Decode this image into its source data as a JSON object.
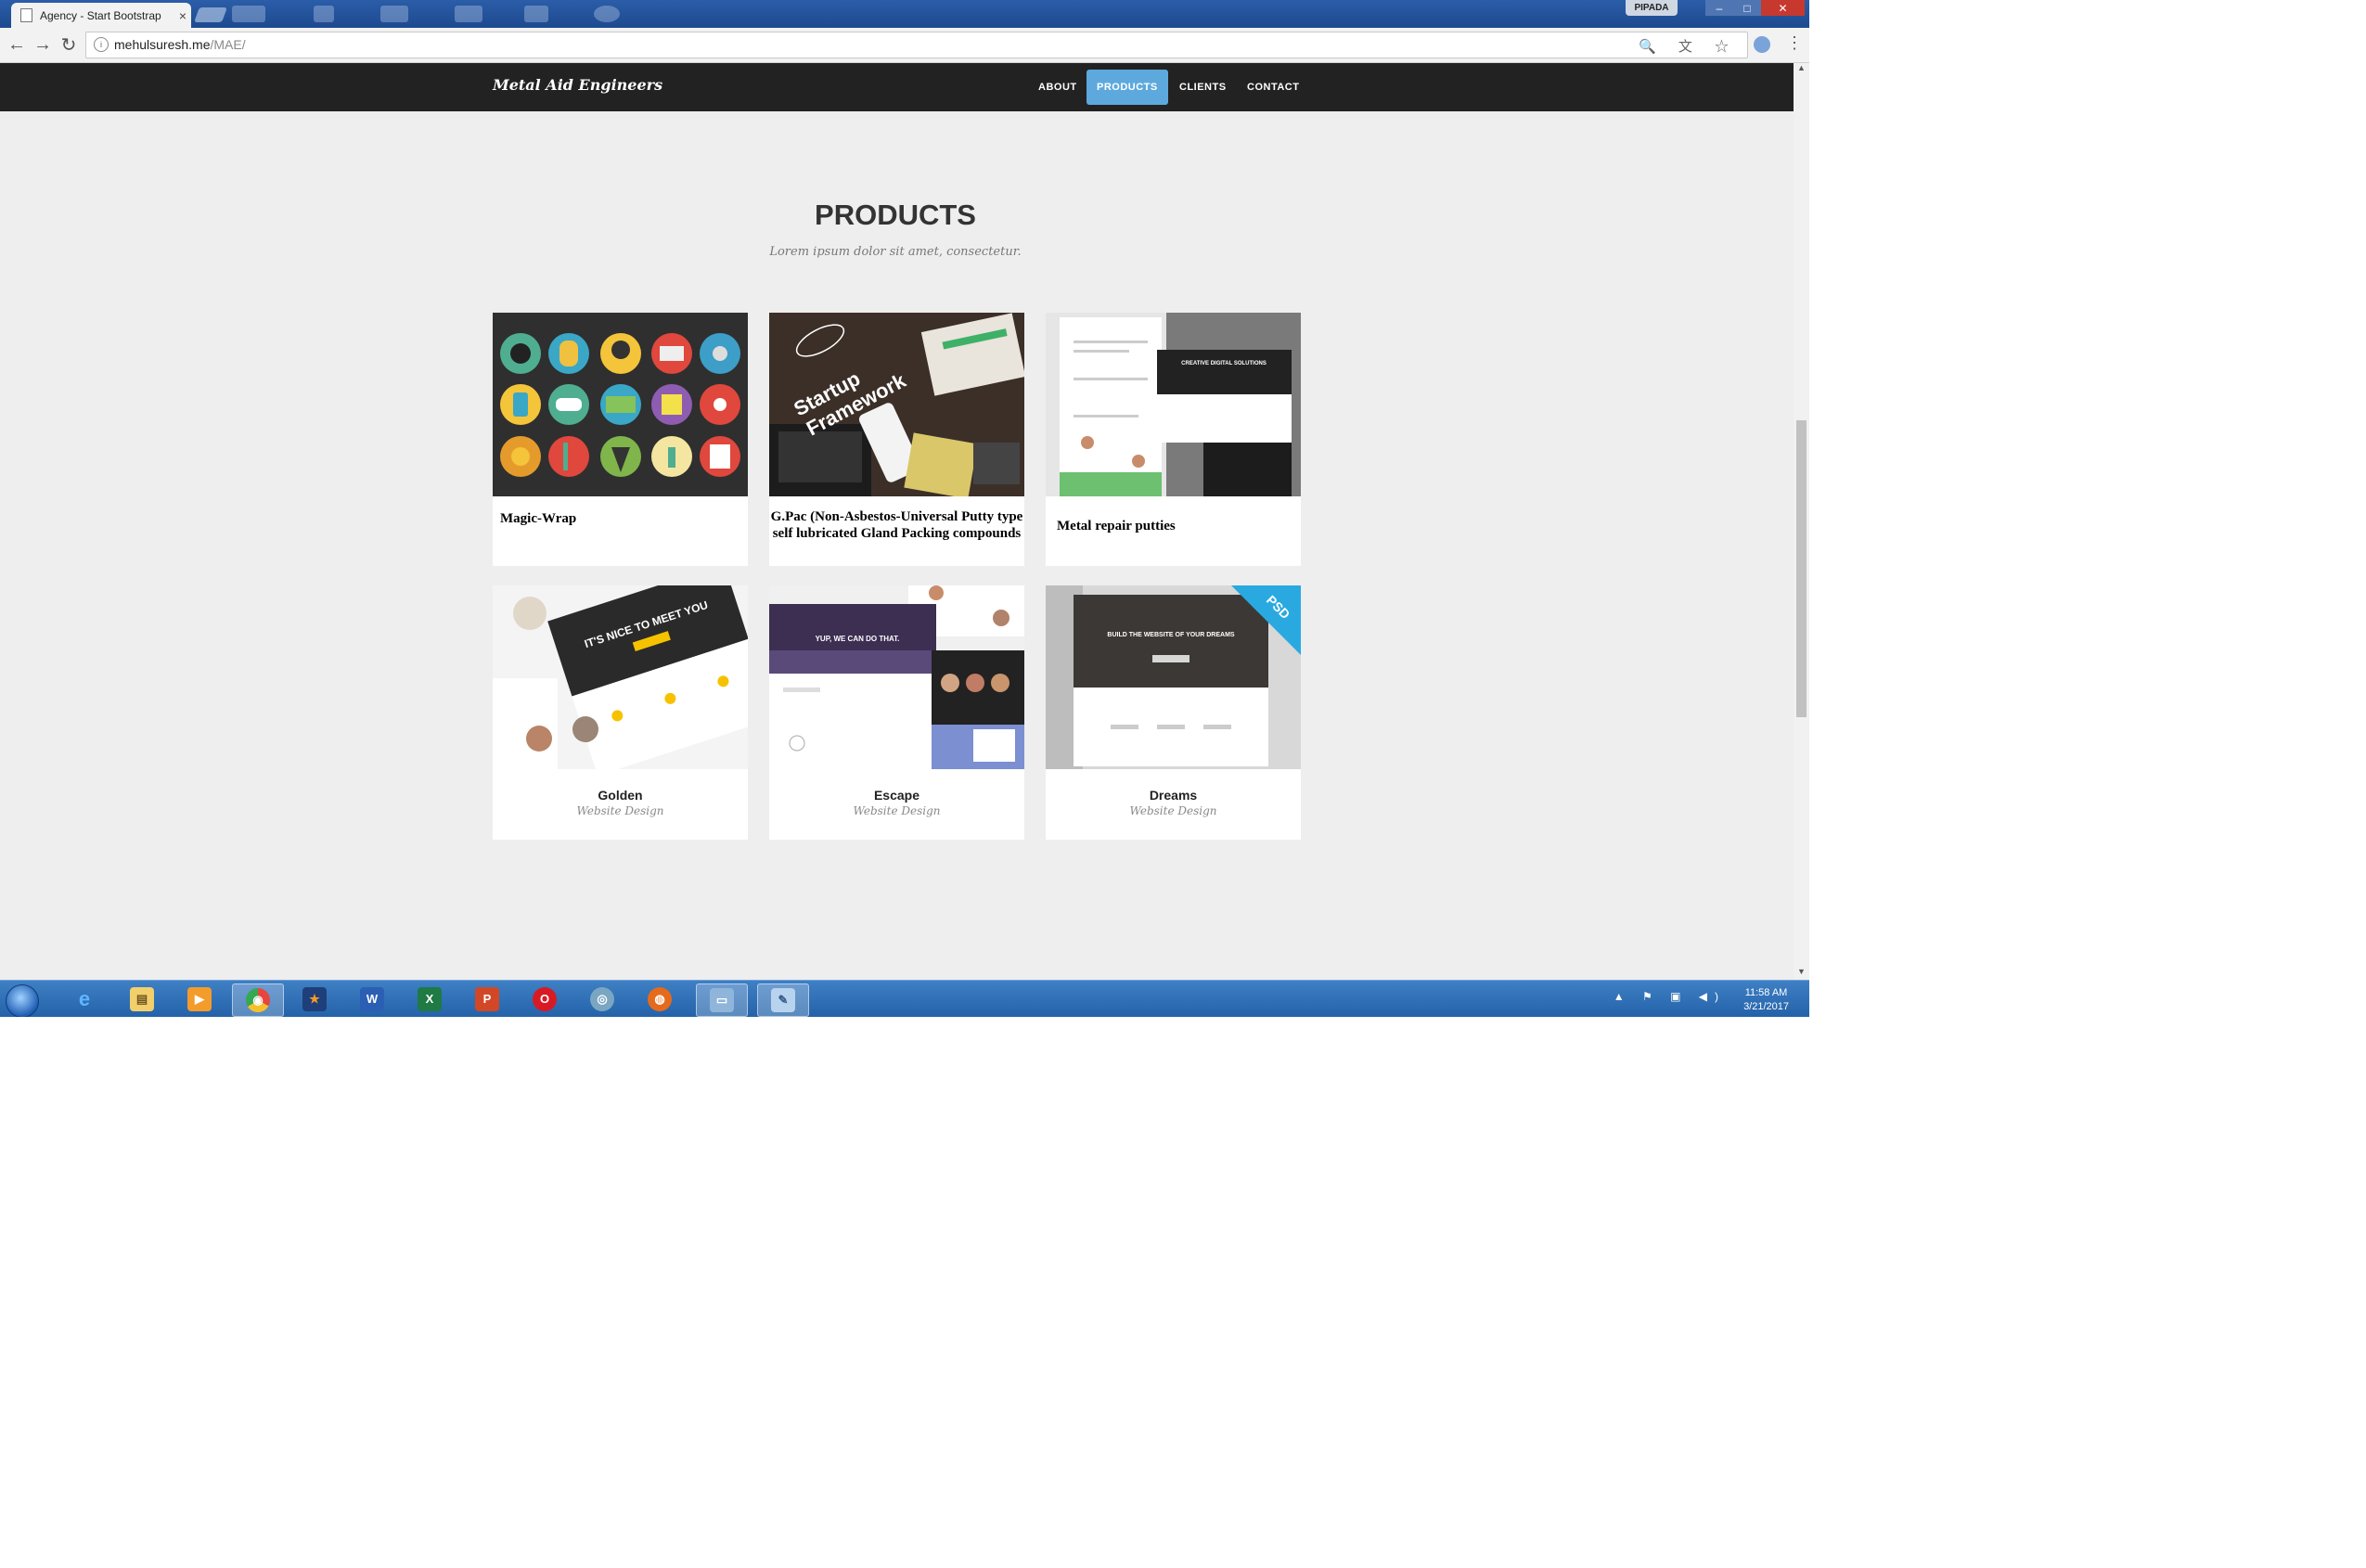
{
  "browser": {
    "tab_title": "Agency - Start Bootstrap",
    "tab_close": "×",
    "user_badge": "PIPADA",
    "window_min": "–",
    "window_max": "□",
    "window_close": "✕",
    "back": "←",
    "forward": "→",
    "reload": "↻",
    "url_host": "mehulsuresh.me",
    "url_path": "/MAE/",
    "omnibox_icons": "🔍 文 ☆",
    "menu": "⋮"
  },
  "site": {
    "brand": "Metal Aid Engineers",
    "nav": [
      "ABOUT",
      "PRODUCTS",
      "CLIENTS",
      "CONTACT"
    ],
    "active_nav": "PRODUCTS",
    "accent_color": "#5da9dd",
    "nav_bg": "#222222"
  },
  "products": {
    "title": "PRODUCTS",
    "subtitle": "Lorem ipsum dolor sit amet, consectetur.",
    "items": [
      {
        "title": "Magic-Wrap",
        "subtitle": ""
      },
      {
        "title": "G.Pac (Non-Asbestos-Universal Putty type self lubricated Gland Packing compounds",
        "subtitle": ""
      },
      {
        "title": "Metal repair putties",
        "subtitle": ""
      },
      {
        "title": "Golden",
        "subtitle": "Website Design"
      },
      {
        "title": "Escape",
        "subtitle": "Website Design"
      },
      {
        "title": "Dreams",
        "subtitle": "Website Design"
      }
    ],
    "thumb_texts": {
      "startup_line1": "Startup",
      "startup_line2": "Framework",
      "creative": "CREATIVE DIGITAL SOLUTIONS",
      "golden": "IT'S NICE TO MEET YOU",
      "escape": "YUP, WE CAN DO THAT.",
      "dreams": "BUILD THE WEBSITE OF YOUR DREAMS",
      "psd": "PSD"
    }
  },
  "taskbar": {
    "apps": [
      "ie-icon",
      "explorer-icon",
      "media-player-icon",
      "chrome-icon",
      "app-icon",
      "word-icon",
      "excel-icon",
      "powerpoint-icon",
      "opera-icon",
      "network-icon",
      "firefox-icon",
      "window-icon",
      "paint-icon"
    ],
    "app_glyphs": [
      "e",
      "▤",
      "▶",
      "◉",
      "★",
      "W",
      "X",
      "P",
      "O",
      "◎",
      "◍",
      "▭",
      "✎"
    ],
    "tray": "▲ ⚑ ▣ ◀)",
    "time": "11:58 AM",
    "date": "3/21/2017"
  }
}
